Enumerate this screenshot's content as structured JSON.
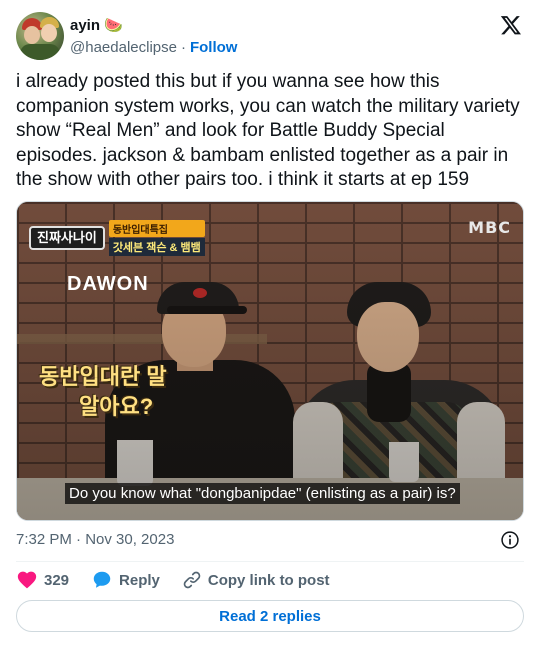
{
  "author": {
    "display_name": "ayin",
    "emoji": "🍉",
    "handle": "@haedaleclipse",
    "separator": "·",
    "follow_label": "Follow"
  },
  "tweet": {
    "text": "i already posted this but if you wanna see how this companion system works, you can watch the military variety show “Real Men” and look for Battle Buddy Special episodes. jackson & bambam enlisted together as a pair in the show with other pairs too. i think it starts at ep 159",
    "timestamp": "7:32 PM · Nov 30, 2023"
  },
  "media": {
    "show_badge": "진짜사나이",
    "banner_top": "동반입대특집",
    "banner_bottom": "갓세븐 잭슨 & 뱀뱀",
    "broadcaster": "MBC",
    "name_tag": "DAWON",
    "korean_caption_line1": "동반입대란 말",
    "korean_caption_line2": "알아요?",
    "subtitle": "Do you know what \"dongbanipdae\" (enlisting as a pair) is?"
  },
  "actions": {
    "like_count": "329",
    "reply_label": "Reply",
    "copy_label": "Copy link to post"
  },
  "read_replies_label": "Read 2 replies",
  "colors": {
    "link_blue": "#006fd6",
    "like_pink": "#f91880",
    "reply_blue": "#1d9bf0",
    "secondary_text": "#536471"
  }
}
